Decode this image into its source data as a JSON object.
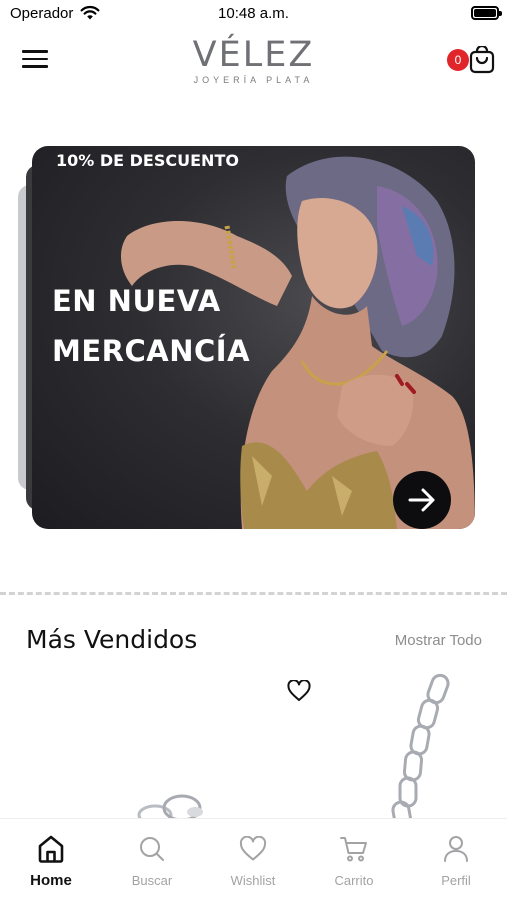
{
  "status_bar": {
    "carrier": "Operador",
    "time": "10:48 a.m."
  },
  "header": {
    "logo_main": "VÉLEZ",
    "logo_sub": "JOYERÍA PLATA",
    "cart_count": "0"
  },
  "banner": {
    "discount": "10% DE DESCUENTO",
    "headline_line1": "EN NUEVA",
    "headline_line2": "MERCANCÍA"
  },
  "section": {
    "title": "Más Vendidos",
    "show_all": "Mostrar Todo"
  },
  "bottom_nav": {
    "items": [
      {
        "label": "Home",
        "icon": "home-icon",
        "active": true
      },
      {
        "label": "Buscar",
        "icon": "search-icon",
        "active": false
      },
      {
        "label": "Wishlist",
        "icon": "heart-icon",
        "active": false
      },
      {
        "label": "Carrito",
        "icon": "cart-icon",
        "active": false
      },
      {
        "label": "Perfil",
        "icon": "user-icon",
        "active": false
      }
    ]
  },
  "colors": {
    "badge": "#e0262b",
    "logo": "#6f7175",
    "inactive_nav": "#a3a3a6"
  }
}
